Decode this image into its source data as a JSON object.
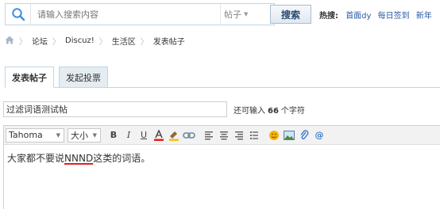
{
  "search": {
    "placeholder": "请输入搜索内容",
    "type_label": "帖子",
    "button_label": "搜索",
    "hot_label": "热搜:",
    "hot_links": [
      "首面dy",
      "每日签到",
      "新年"
    ]
  },
  "breadcrumb": {
    "items": [
      "论坛",
      "Discuz!",
      "生活区",
      "发表帖子"
    ]
  },
  "tabs": [
    {
      "label": "发表帖子"
    },
    {
      "label": "发起投票"
    }
  ],
  "post": {
    "title_value": "过滤词语测试帖",
    "remain_prefix": "还可输入",
    "remain_count": "66",
    "remain_suffix": "个字符"
  },
  "editor": {
    "font_family": "Tahoma",
    "font_size": "大小",
    "content_before": "大家都不要说",
    "content_filtered": "NNND",
    "content_after": "这类的词语。"
  },
  "colors": {
    "accent_blue": "#2b5aa6",
    "border_blue": "#c2d5e3",
    "tab_inactive_bg": "#e5edf2",
    "misspell_red": "#e02020"
  }
}
